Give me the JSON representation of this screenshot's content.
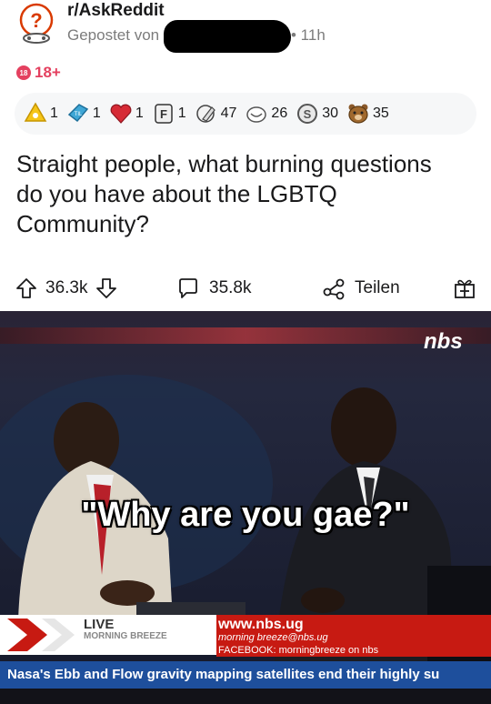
{
  "header": {
    "subreddit": "r/AskReddit",
    "posted_by": "Gepostet von",
    "time": "• 11h"
  },
  "nsfw": {
    "badge": "18",
    "label": "18+"
  },
  "awards": [
    {
      "icon": "helpful-award-icon",
      "count": "1"
    },
    {
      "icon": "til-award-icon",
      "count": "1"
    },
    {
      "icon": "heart-award-icon",
      "count": "1"
    },
    {
      "icon": "press-f-award-icon",
      "count": "1"
    },
    {
      "icon": "facepalm-award-icon",
      "count": "47"
    },
    {
      "icon": "bravo-award-icon",
      "count": "26"
    },
    {
      "icon": "silver-award-icon",
      "count": "30"
    },
    {
      "icon": "bear-award-icon",
      "count": "35"
    }
  ],
  "post": {
    "title": "Straight people, what burning questions do you have about the LGBTQ Community?"
  },
  "actions": {
    "votes": "36.3k",
    "comments": "35.8k",
    "share": "Teilen"
  },
  "media": {
    "caption": "\"Why are you gae?\"",
    "channel_logo": "nbs",
    "live": "LIVE",
    "show": "MORNING BREEZE",
    "website": "www.nbs.ug",
    "email": "morning breeze@nbs.ug",
    "facebook": "FACEBOOK: morningbreeze on nbs",
    "ticker": "Nasa's Ebb and Flow gravity mapping satellites end their highly su"
  },
  "colors": {
    "nsfw": "#e4405f",
    "awards_bg": "#f6f7f8",
    "ticker": "#1e4f9c",
    "lower_third": "#c71a12"
  }
}
